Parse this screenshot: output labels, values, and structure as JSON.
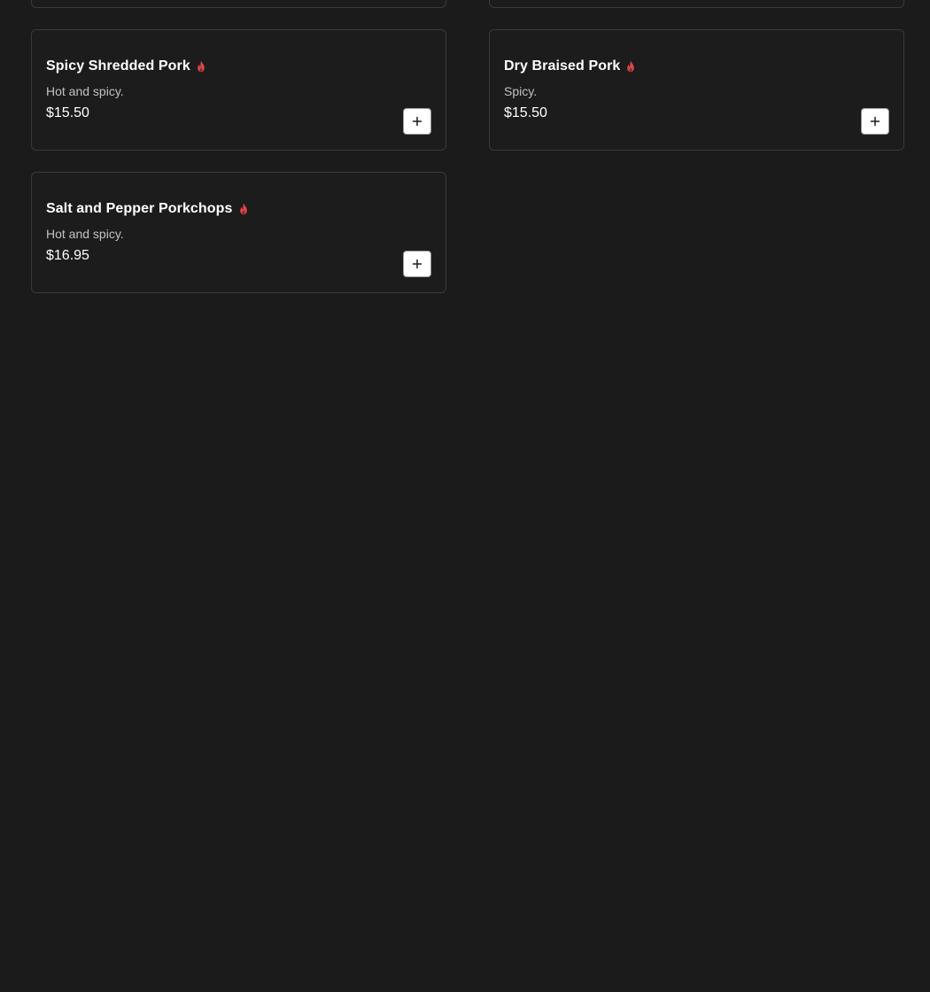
{
  "theme": {
    "background": "#1b1b1b",
    "card_border": "#3a3a3a",
    "spicy_color": "#e0454b",
    "add_button_bg": "#ffffff"
  },
  "menu": {
    "items": [
      {
        "name": "Spicy Shredded Pork",
        "description": "Hot and spicy.",
        "price": "$15.50",
        "icon": "flame-icon",
        "action_icon": "plus-icon"
      },
      {
        "name": "Dry Braised Pork",
        "description": "Spicy.",
        "price": "$15.50",
        "icon": "flame-icon",
        "action_icon": "plus-icon"
      },
      {
        "name": "Salt and Pepper Porkchops",
        "description": "Hot and spicy.",
        "price": "$16.95",
        "icon": "flame-icon",
        "action_icon": "plus-icon"
      }
    ]
  }
}
